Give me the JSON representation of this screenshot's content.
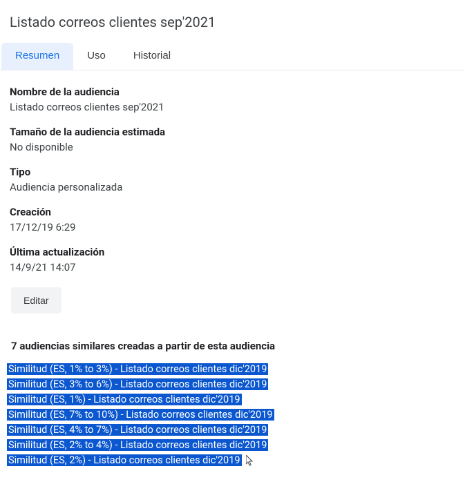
{
  "page_title": "Listado correos clientes sep'2021",
  "tabs": {
    "resumen": "Resumen",
    "uso": "Uso",
    "historial": "Historial"
  },
  "fields": {
    "name_label": "Nombre de la audiencia",
    "name_value": "Listado correos clientes sep'2021",
    "size_label": "Tamaño de la audiencia estimada",
    "size_value": "No disponible",
    "type_label": "Tipo",
    "type_value": "Audiencia personalizada",
    "created_label": "Creación",
    "created_value": "17/12/19 6:29",
    "updated_label": "Última actualización",
    "updated_value": "14/9/21 14:07"
  },
  "edit_button": "Editar",
  "similar_heading": "7 audiencias similares creadas a partir de esta audiencia",
  "similar_items": [
    "Similitud (ES, 1% to 3%) - Listado correos clientes dic'2019",
    "Similitud (ES, 3% to 6%) - Listado correos clientes dic'2019",
    "Similitud (ES, 1%) - Listado correos clientes dic'2019",
    "Similitud (ES, 7% to 10%) - Listado correos clientes dic'2019",
    "Similitud (ES, 4% to 7%) - Listado correos clientes dic'2019",
    "Similitud (ES, 2% to 4%) - Listado correos clientes dic'2019",
    "Similitud (ES, 2%) - Listado correos clientes dic'2019"
  ]
}
